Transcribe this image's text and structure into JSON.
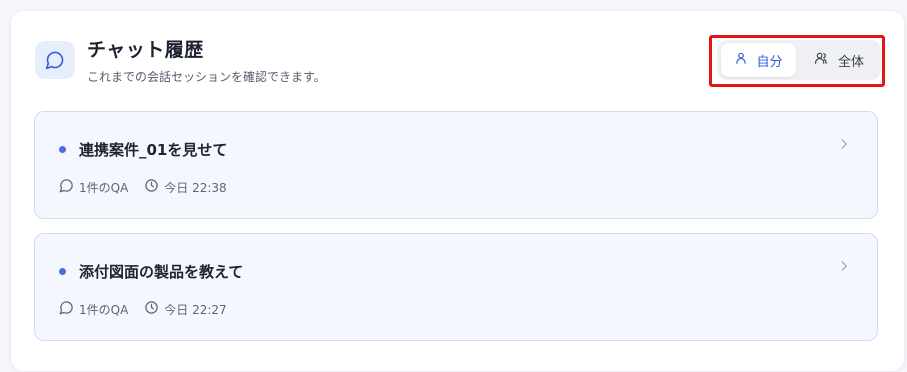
{
  "header": {
    "title": "チャット履歴",
    "subtitle": "これまでの会話セッションを確認できます。",
    "icon": "chat-bubble-icon"
  },
  "scope_toggle": {
    "options": [
      {
        "label": "自分",
        "icon": "user-icon",
        "selected": true
      },
      {
        "label": "全体",
        "icon": "users-icon",
        "selected": false
      }
    ],
    "accent_color": "#2f5bd8",
    "highlight_color": "#e41414"
  },
  "sessions": [
    {
      "title": "連携案件_01を見せて",
      "qa_count": "1件のQA",
      "time": "今日 22:38"
    },
    {
      "title": "添付図面の製品を教えて",
      "qa_count": "1件のQA",
      "time": "今日 22:27"
    }
  ]
}
